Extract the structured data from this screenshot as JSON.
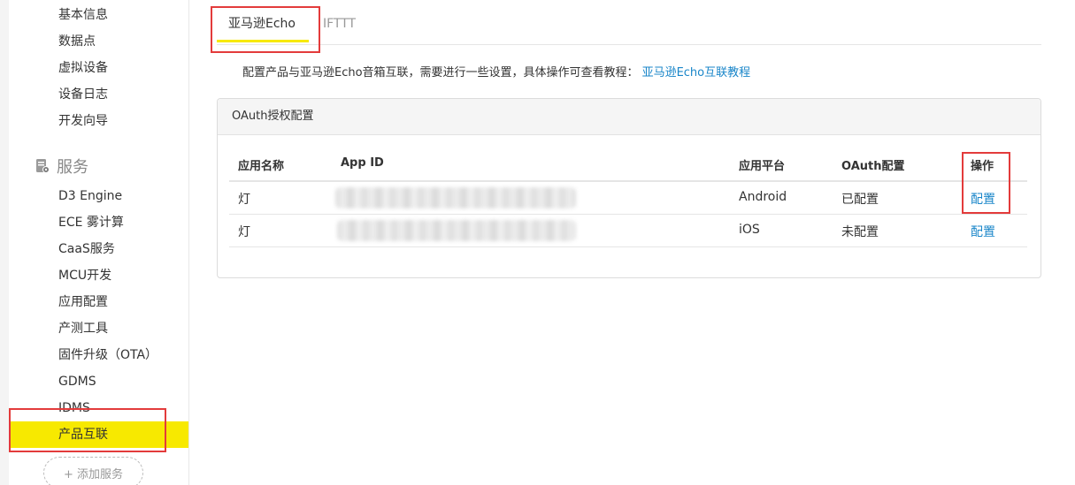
{
  "sidebar": {
    "items_top": [
      "基本信息",
      "数据点",
      "虚拟设备",
      "设备日志",
      "开发向导"
    ],
    "section_title": "服务",
    "items": [
      "D3 Engine",
      "ECE 雾计算",
      "CaaS服务",
      "MCU开发",
      "应用配置",
      "产测工具",
      "固件升级（OTA）",
      "GDMS",
      "IDMS",
      "产品互联"
    ],
    "active_item": "产品互联",
    "add_service": "+ 添加服务"
  },
  "tabs": [
    {
      "label": "亚马逊Echo",
      "active": true
    },
    {
      "label": "IFTTT",
      "active": false
    }
  ],
  "intro": {
    "text": "配置产品与亚马逊Echo音箱互联，需要进行一些设置，具体操作可查看教程：",
    "link": "亚马逊Echo互联教程"
  },
  "panel": {
    "title": "OAuth授权配置",
    "columns": [
      "应用名称",
      "App ID",
      "应用平台",
      "OAuth配置",
      "操作"
    ],
    "rows": [
      {
        "name": "灯",
        "platform": "Android",
        "status": "已配置",
        "action": "配置"
      },
      {
        "name": "灯",
        "platform": "iOS",
        "status": "未配置",
        "action": "配置"
      }
    ]
  },
  "colors": {
    "accent_yellow": "#f7e900",
    "link_blue": "#1a86c9",
    "highlight_red": "#e33b3b"
  }
}
